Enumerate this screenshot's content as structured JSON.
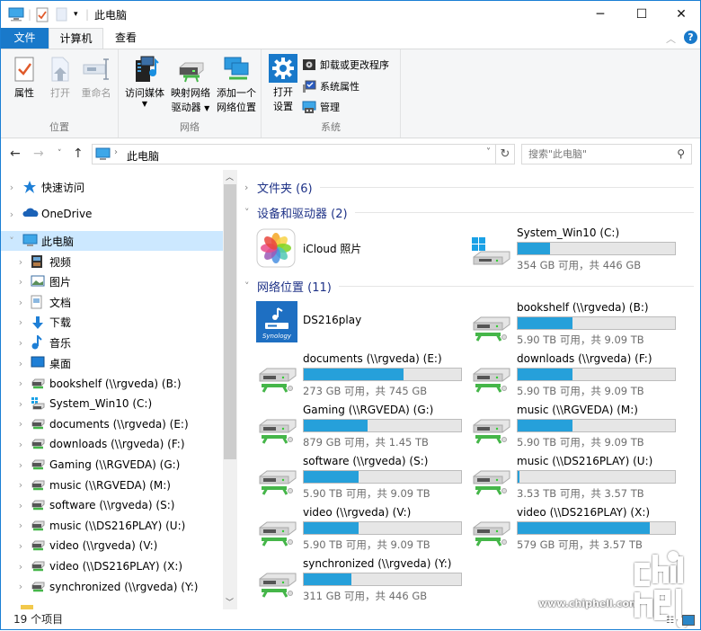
{
  "window": {
    "title": "此电脑",
    "controls": {
      "minimize": "─",
      "maximize": "☐",
      "close": "✕"
    }
  },
  "ribbon": {
    "tabs": [
      {
        "label": "文件"
      },
      {
        "label": "计算机"
      },
      {
        "label": "查看"
      }
    ],
    "groups": [
      {
        "label": "位置",
        "buttons": [
          {
            "label": "属性",
            "icon": "properties-icon",
            "enabled": true
          },
          {
            "label": "打开",
            "icon": "open-icon",
            "enabled": false
          },
          {
            "label": "重命名",
            "icon": "rename-icon",
            "enabled": false
          }
        ]
      },
      {
        "label": "网络",
        "buttons": [
          {
            "label": "访问媒体",
            "icon": "media-icon",
            "has_dropdown": true
          },
          {
            "label": "映射网络",
            "label2": "驱动器",
            "icon": "map-drive-icon",
            "has_dropdown": true
          },
          {
            "label": "添加一个",
            "label2": "网络位置",
            "icon": "network-location-icon"
          }
        ]
      },
      {
        "label": "系统",
        "buttons": [
          {
            "label": "打开",
            "label2": "设置",
            "icon": "settings-gear-icon"
          }
        ],
        "small_buttons": [
          {
            "label": "卸载或更改程序",
            "icon": "uninstall-icon"
          },
          {
            "label": "系统属性",
            "icon": "system-properties-icon"
          },
          {
            "label": "管理",
            "icon": "manage-icon"
          }
        ]
      }
    ]
  },
  "addressbar": {
    "path": "此电脑",
    "search_placeholder": "搜索\"此电脑\""
  },
  "navpane": {
    "items": [
      {
        "label": "快速访问",
        "icon": "star-icon",
        "level": 0,
        "expanded": false
      },
      {
        "label": "OneDrive",
        "icon": "cloud-icon",
        "level": 0,
        "expanded": false
      },
      {
        "label": "此电脑",
        "icon": "computer-icon",
        "level": 0,
        "expanded": true,
        "selected": true
      },
      {
        "label": "视频",
        "icon": "video-folder-icon",
        "level": 1
      },
      {
        "label": "图片",
        "icon": "pictures-folder-icon",
        "level": 1
      },
      {
        "label": "文档",
        "icon": "documents-folder-icon",
        "level": 1
      },
      {
        "label": "下载",
        "icon": "download-arrow-icon",
        "level": 1
      },
      {
        "label": "音乐",
        "icon": "music-note-icon",
        "level": 1
      },
      {
        "label": "桌面",
        "icon": "desktop-icon",
        "level": 1
      },
      {
        "label": "bookshelf (\\\\rgveda) (B:)",
        "icon": "network-drive-icon",
        "level": 1
      },
      {
        "label": "System_Win10 (C:)",
        "icon": "system-drive-icon",
        "level": 1
      },
      {
        "label": "documents (\\\\rgveda) (E:)",
        "icon": "network-drive-icon",
        "level": 1
      },
      {
        "label": "downloads (\\\\rgveda) (F:)",
        "icon": "network-drive-icon",
        "level": 1
      },
      {
        "label": "Gaming (\\\\RGVEDA) (G:)",
        "icon": "network-drive-icon",
        "level": 1
      },
      {
        "label": "music (\\\\RGVEDA) (M:)",
        "icon": "network-drive-icon",
        "level": 1
      },
      {
        "label": "software (\\\\rgveda) (S:)",
        "icon": "network-drive-icon",
        "level": 1
      },
      {
        "label": "music (\\\\DS216PLAY) (U:)",
        "icon": "network-drive-icon",
        "level": 1
      },
      {
        "label": "video (\\\\rgveda) (V:)",
        "icon": "network-drive-icon",
        "level": 1
      },
      {
        "label": "video (\\\\DS216PLAY) (X:)",
        "icon": "network-drive-icon",
        "level": 1
      },
      {
        "label": "synchronized (\\\\rgveda) (Y:)",
        "icon": "network-drive-icon",
        "level": 1
      }
    ]
  },
  "content": {
    "groups": [
      {
        "title": "文件夹 (6)",
        "expanded": false
      },
      {
        "title": "设备和驱动器 (2)",
        "expanded": true
      },
      {
        "title": "网络位置 (11)",
        "expanded": true
      }
    ],
    "devices": [
      {
        "name": "iCloud 照片",
        "icon": "icloud-photos-icon"
      },
      {
        "name": "System_Win10 (C:)",
        "icon": "system-drive-icon",
        "used_fraction": 0.206,
        "info": "354 GB 可用，共 446 GB"
      }
    ],
    "network": [
      {
        "name": "DS216play",
        "icon": "synology-icon"
      },
      {
        "name": "bookshelf (\\\\rgveda) (B:)",
        "used_fraction": 0.35,
        "info": "5.90 TB 可用，共 9.09 TB"
      },
      {
        "name": "documents (\\\\rgveda) (E:)",
        "used_fraction": 0.633,
        "info": "273 GB 可用，共 745 GB"
      },
      {
        "name": "downloads (\\\\rgveda) (F:)",
        "used_fraction": 0.35,
        "info": "5.90 TB 可用，共 9.09 TB"
      },
      {
        "name": "Gaming (\\\\RGVEDA) (G:)",
        "used_fraction": 0.408,
        "info": "879 GB 可用，共 1.45 TB"
      },
      {
        "name": "music (\\\\RGVEDA) (M:)",
        "used_fraction": 0.35,
        "info": "5.90 TB 可用，共 9.09 TB"
      },
      {
        "name": "software (\\\\rgveda) (S:)",
        "used_fraction": 0.35,
        "info": "5.90 TB 可用，共 9.09 TB"
      },
      {
        "name": "music (\\\\DS216PLAY) (U:)",
        "used_fraction": 0.011,
        "info": "3.53 TB 可用，共 3.57 TB"
      },
      {
        "name": "video (\\\\rgveda) (V:)",
        "used_fraction": 0.35,
        "info": "5.90 TB 可用，共 9.09 TB"
      },
      {
        "name": "video (\\\\DS216PLAY) (X:)",
        "used_fraction": 0.842,
        "info": "579 GB 可用，共 3.57 TB"
      },
      {
        "name": "synchronized (\\\\rgveda) (Y:)",
        "used_fraction": 0.303,
        "info": "311 GB 可用，共 446 GB"
      }
    ]
  },
  "statusbar": {
    "count": "19 个项目"
  },
  "watermark": {
    "text": "www.chiphell.com",
    "logo": "chip hell"
  },
  "colors": {
    "accent": "#1979ca",
    "bar_fill": "#26a0da",
    "selection": "#cce8ff",
    "group_title": "#1e3287"
  }
}
